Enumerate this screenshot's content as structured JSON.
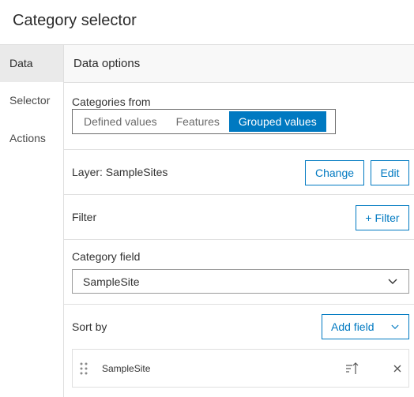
{
  "header": {
    "title": "Category selector"
  },
  "sidebar": {
    "items": [
      {
        "label": "Data"
      },
      {
        "label": "Selector"
      },
      {
        "label": "Actions"
      }
    ]
  },
  "panel": {
    "title": "Data options",
    "categories": {
      "label": "Categories from",
      "options": [
        "Defined values",
        "Features",
        "Grouped values"
      ],
      "selected": "Grouped values"
    },
    "layer": {
      "label": "Layer: SampleSites",
      "change_label": "Change",
      "edit_label": "Edit"
    },
    "filter": {
      "label": "Filter",
      "button_label": "+ Filter"
    },
    "category_field": {
      "label": "Category field",
      "value": "SampleSite"
    },
    "sort": {
      "label": "Sort by",
      "add_label": "Add field",
      "fields": [
        {
          "name": "SampleSite"
        }
      ]
    }
  },
  "colors": {
    "accent": "#0079c1",
    "border": "#dfdfdf",
    "active_nav": "#eaeaea"
  },
  "icons": [
    "drag-handle-icon",
    "sort-ascending-icon",
    "close-icon",
    "chevron-down-icon"
  ]
}
